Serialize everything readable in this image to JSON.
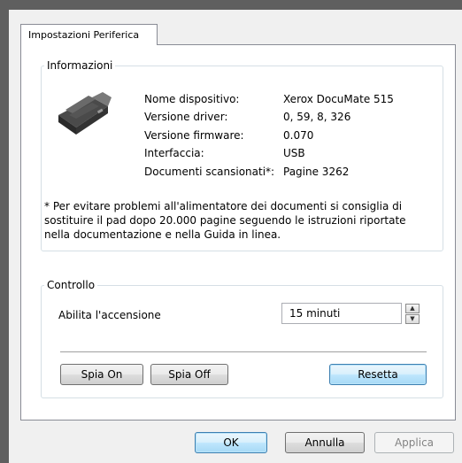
{
  "tab": {
    "label": "Impostazioni Periferica"
  },
  "info": {
    "group_label": "Informazioni",
    "rows": [
      {
        "label": "Nome dispositivo:",
        "value": "Xerox DocuMate 515"
      },
      {
        "label": "Versione driver:",
        "value": "0, 59, 8, 326"
      },
      {
        "label": "Versione firmware:",
        "value": "0.070"
      },
      {
        "label": "Interfaccia:",
        "value": "USB"
      },
      {
        "label": "Documenti scansionati*:",
        "value": "Pagine 3262"
      }
    ],
    "note": "* Per evitare problemi all'alimentatore dei documenti si consiglia di sostituire il pad dopo 20.000 pagine seguendo le istruzioni riportate nella documentazione e nella Guida in linea."
  },
  "control": {
    "group_label": "Controllo",
    "power_label": "Abilita l'accensione",
    "power_value": "15 minuti",
    "spia_on": "Spia On",
    "spia_off": "Spia Off",
    "reset": "Resetta"
  },
  "footer": {
    "ok": "OK",
    "cancel": "Annulla",
    "apply": "Applica"
  },
  "icons": {
    "device": "scanner-icon"
  }
}
